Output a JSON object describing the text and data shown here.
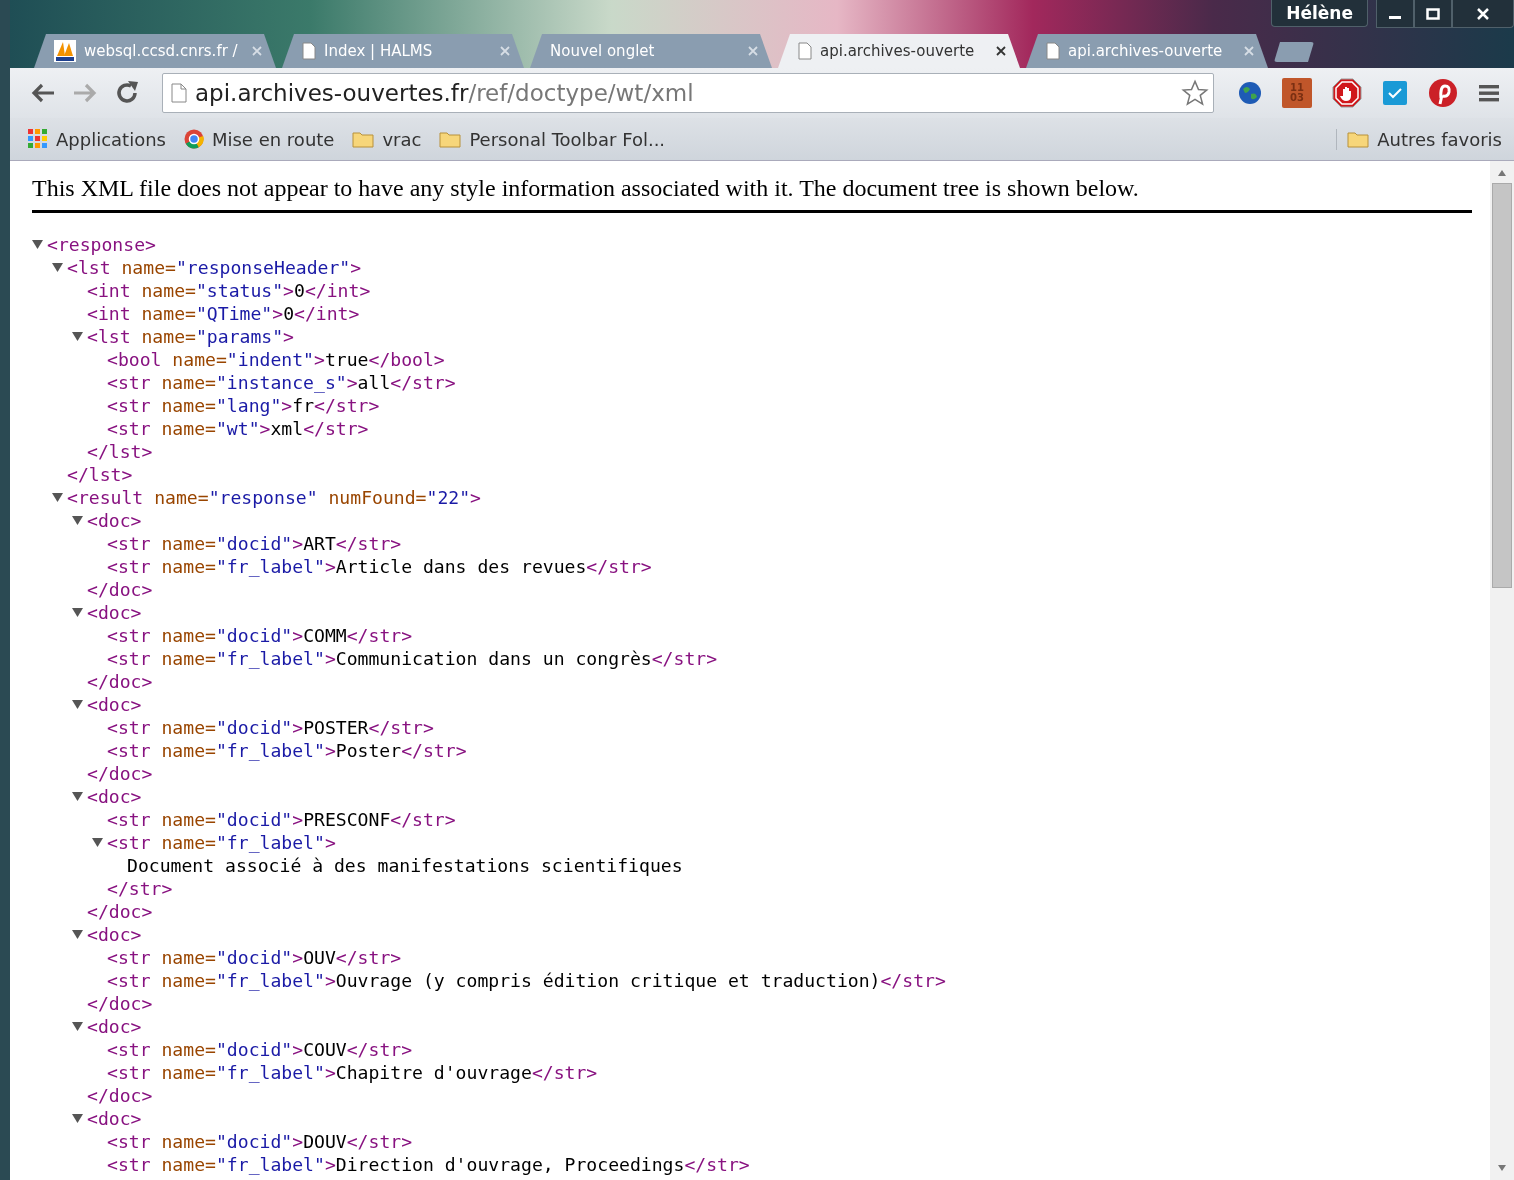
{
  "window": {
    "user": "Hélène"
  },
  "tabs": [
    {
      "title": "websql.ccsd.cnrs.fr /",
      "kind": "site",
      "selected": false
    },
    {
      "title": "Index | HALMS",
      "kind": "page",
      "selected": false
    },
    {
      "title": "Nouvel onglet",
      "kind": "blank",
      "selected": false
    },
    {
      "title": "api.archives-ouverte",
      "kind": "page",
      "selected": true
    },
    {
      "title": "api.archives-ouverte",
      "kind": "page",
      "selected": false
    }
  ],
  "toolbar": {
    "back_disabled": false,
    "forward_disabled": true,
    "url_host": "api.archives-ouvertes.fr",
    "url_path": "/ref/doctype/wt/xml",
    "calendar_day": "11",
    "calendar_month": "03"
  },
  "bookmarks": [
    {
      "label": "Applications",
      "kind": "apps"
    },
    {
      "label": "Mise en route",
      "kind": "site"
    },
    {
      "label": "vrac",
      "kind": "folder"
    },
    {
      "label": "Personal Toolbar Fol...",
      "kind": "folder"
    }
  ],
  "other_bookmarks": {
    "label": "Autres favoris"
  },
  "document": {
    "notice": "This XML file does not appear to have any style information associated with it. The document tree is shown below.",
    "tree": [
      {
        "expanded": true,
        "open": [
          {
            "kind": "tag",
            "text": "<response>"
          }
        ],
        "children": [
          {
            "expanded": true,
            "open": [
              {
                "kind": "tag",
                "text": "<lst"
              },
              {
                "kind": "attr",
                "text": " name="
              },
              {
                "kind": "value",
                "text": "\"responseHeader\""
              },
              {
                "kind": "tag",
                "text": ">"
              }
            ],
            "children": [
              {
                "line": [
                  {
                    "kind": "tag",
                    "text": "<int"
                  },
                  {
                    "kind": "attr",
                    "text": " name="
                  },
                  {
                    "kind": "value",
                    "text": "\"status\""
                  },
                  {
                    "kind": "tag",
                    "text": ">"
                  },
                  {
                    "kind": "text",
                    "text": "0"
                  },
                  {
                    "kind": "tag",
                    "text": "</int>"
                  }
                ]
              },
              {
                "line": [
                  {
                    "kind": "tag",
                    "text": "<int"
                  },
                  {
                    "kind": "attr",
                    "text": " name="
                  },
                  {
                    "kind": "value",
                    "text": "\"QTime\""
                  },
                  {
                    "kind": "tag",
                    "text": ">"
                  },
                  {
                    "kind": "text",
                    "text": "0"
                  },
                  {
                    "kind": "tag",
                    "text": "</int>"
                  }
                ]
              },
              {
                "expanded": true,
                "open": [
                  {
                    "kind": "tag",
                    "text": "<lst"
                  },
                  {
                    "kind": "attr",
                    "text": " name="
                  },
                  {
                    "kind": "value",
                    "text": "\"params\""
                  },
                  {
                    "kind": "tag",
                    "text": ">"
                  }
                ],
                "children": [
                  {
                    "line": [
                      {
                        "kind": "tag",
                        "text": "<bool"
                      },
                      {
                        "kind": "attr",
                        "text": " name="
                      },
                      {
                        "kind": "value",
                        "text": "\"indent\""
                      },
                      {
                        "kind": "tag",
                        "text": ">"
                      },
                      {
                        "kind": "text",
                        "text": "true"
                      },
                      {
                        "kind": "tag",
                        "text": "</bool>"
                      }
                    ]
                  },
                  {
                    "line": [
                      {
                        "kind": "tag",
                        "text": "<str"
                      },
                      {
                        "kind": "attr",
                        "text": " name="
                      },
                      {
                        "kind": "value",
                        "text": "\"instance_s\""
                      },
                      {
                        "kind": "tag",
                        "text": ">"
                      },
                      {
                        "kind": "text",
                        "text": "all"
                      },
                      {
                        "kind": "tag",
                        "text": "</str>"
                      }
                    ]
                  },
                  {
                    "line": [
                      {
                        "kind": "tag",
                        "text": "<str"
                      },
                      {
                        "kind": "attr",
                        "text": " name="
                      },
                      {
                        "kind": "value",
                        "text": "\"lang\""
                      },
                      {
                        "kind": "tag",
                        "text": ">"
                      },
                      {
                        "kind": "text",
                        "text": "fr"
                      },
                      {
                        "kind": "tag",
                        "text": "</str>"
                      }
                    ]
                  },
                  {
                    "line": [
                      {
                        "kind": "tag",
                        "text": "<str"
                      },
                      {
                        "kind": "attr",
                        "text": " name="
                      },
                      {
                        "kind": "value",
                        "text": "\"wt\""
                      },
                      {
                        "kind": "tag",
                        "text": ">"
                      },
                      {
                        "kind": "text",
                        "text": "xml"
                      },
                      {
                        "kind": "tag",
                        "text": "</str>"
                      }
                    ]
                  }
                ],
                "close": [
                  {
                    "kind": "tag",
                    "text": "</lst>"
                  }
                ]
              }
            ],
            "close": [
              {
                "kind": "tag",
                "text": "</lst>"
              }
            ]
          },
          {
            "expanded": true,
            "open": [
              {
                "kind": "tag",
                "text": "<result"
              },
              {
                "kind": "attr",
                "text": " name="
              },
              {
                "kind": "value",
                "text": "\"response\""
              },
              {
                "kind": "attr",
                "text": " numFound="
              },
              {
                "kind": "value",
                "text": "\"22\""
              },
              {
                "kind": "tag",
                "text": ">"
              }
            ],
            "children": [
              {
                "expanded": true,
                "open": [
                  {
                    "kind": "tag",
                    "text": "<doc>"
                  }
                ],
                "children": [
                  {
                    "line": [
                      {
                        "kind": "tag",
                        "text": "<str"
                      },
                      {
                        "kind": "attr",
                        "text": " name="
                      },
                      {
                        "kind": "value",
                        "text": "\"docid\""
                      },
                      {
                        "kind": "tag",
                        "text": ">"
                      },
                      {
                        "kind": "text",
                        "text": "ART"
                      },
                      {
                        "kind": "tag",
                        "text": "</str>"
                      }
                    ]
                  },
                  {
                    "line": [
                      {
                        "kind": "tag",
                        "text": "<str"
                      },
                      {
                        "kind": "attr",
                        "text": " name="
                      },
                      {
                        "kind": "value",
                        "text": "\"fr_label\""
                      },
                      {
                        "kind": "tag",
                        "text": ">"
                      },
                      {
                        "kind": "text",
                        "text": "Article dans des revues"
                      },
                      {
                        "kind": "tag",
                        "text": "</str>"
                      }
                    ]
                  }
                ],
                "close": [
                  {
                    "kind": "tag",
                    "text": "</doc>"
                  }
                ]
              },
              {
                "expanded": true,
                "open": [
                  {
                    "kind": "tag",
                    "text": "<doc>"
                  }
                ],
                "children": [
                  {
                    "line": [
                      {
                        "kind": "tag",
                        "text": "<str"
                      },
                      {
                        "kind": "attr",
                        "text": " name="
                      },
                      {
                        "kind": "value",
                        "text": "\"docid\""
                      },
                      {
                        "kind": "tag",
                        "text": ">"
                      },
                      {
                        "kind": "text",
                        "text": "COMM"
                      },
                      {
                        "kind": "tag",
                        "text": "</str>"
                      }
                    ]
                  },
                  {
                    "line": [
                      {
                        "kind": "tag",
                        "text": "<str"
                      },
                      {
                        "kind": "attr",
                        "text": " name="
                      },
                      {
                        "kind": "value",
                        "text": "\"fr_label\""
                      },
                      {
                        "kind": "tag",
                        "text": ">"
                      },
                      {
                        "kind": "text",
                        "text": "Communication dans un congrès"
                      },
                      {
                        "kind": "tag",
                        "text": "</str>"
                      }
                    ]
                  }
                ],
                "close": [
                  {
                    "kind": "tag",
                    "text": "</doc>"
                  }
                ]
              },
              {
                "expanded": true,
                "open": [
                  {
                    "kind": "tag",
                    "text": "<doc>"
                  }
                ],
                "children": [
                  {
                    "line": [
                      {
                        "kind": "tag",
                        "text": "<str"
                      },
                      {
                        "kind": "attr",
                        "text": " name="
                      },
                      {
                        "kind": "value",
                        "text": "\"docid\""
                      },
                      {
                        "kind": "tag",
                        "text": ">"
                      },
                      {
                        "kind": "text",
                        "text": "POSTER"
                      },
                      {
                        "kind": "tag",
                        "text": "</str>"
                      }
                    ]
                  },
                  {
                    "line": [
                      {
                        "kind": "tag",
                        "text": "<str"
                      },
                      {
                        "kind": "attr",
                        "text": " name="
                      },
                      {
                        "kind": "value",
                        "text": "\"fr_label\""
                      },
                      {
                        "kind": "tag",
                        "text": ">"
                      },
                      {
                        "kind": "text",
                        "text": "Poster"
                      },
                      {
                        "kind": "tag",
                        "text": "</str>"
                      }
                    ]
                  }
                ],
                "close": [
                  {
                    "kind": "tag",
                    "text": "</doc>"
                  }
                ]
              },
              {
                "expanded": true,
                "open": [
                  {
                    "kind": "tag",
                    "text": "<doc>"
                  }
                ],
                "children": [
                  {
                    "line": [
                      {
                        "kind": "tag",
                        "text": "<str"
                      },
                      {
                        "kind": "attr",
                        "text": " name="
                      },
                      {
                        "kind": "value",
                        "text": "\"docid\""
                      },
                      {
                        "kind": "tag",
                        "text": ">"
                      },
                      {
                        "kind": "text",
                        "text": "PRESCONF"
                      },
                      {
                        "kind": "tag",
                        "text": "</str>"
                      }
                    ]
                  },
                  {
                    "expanded": true,
                    "open": [
                      {
                        "kind": "tag",
                        "text": "<str"
                      },
                      {
                        "kind": "attr",
                        "text": " name="
                      },
                      {
                        "kind": "value",
                        "text": "\"fr_label\""
                      },
                      {
                        "kind": "tag",
                        "text": ">"
                      }
                    ],
                    "children": [
                      {
                        "line": [
                          {
                            "kind": "text",
                            "text": "Document associé à des manifestations scientifiques"
                          }
                        ]
                      }
                    ],
                    "close": [
                      {
                        "kind": "tag",
                        "text": "</str>"
                      }
                    ]
                  }
                ],
                "close": [
                  {
                    "kind": "tag",
                    "text": "</doc>"
                  }
                ]
              },
              {
                "expanded": true,
                "open": [
                  {
                    "kind": "tag",
                    "text": "<doc>"
                  }
                ],
                "children": [
                  {
                    "line": [
                      {
                        "kind": "tag",
                        "text": "<str"
                      },
                      {
                        "kind": "attr",
                        "text": " name="
                      },
                      {
                        "kind": "value",
                        "text": "\"docid\""
                      },
                      {
                        "kind": "tag",
                        "text": ">"
                      },
                      {
                        "kind": "text",
                        "text": "OUV"
                      },
                      {
                        "kind": "tag",
                        "text": "</str>"
                      }
                    ]
                  },
                  {
                    "line": [
                      {
                        "kind": "tag",
                        "text": "<str"
                      },
                      {
                        "kind": "attr",
                        "text": " name="
                      },
                      {
                        "kind": "value",
                        "text": "\"fr_label\""
                      },
                      {
                        "kind": "tag",
                        "text": ">"
                      },
                      {
                        "kind": "text",
                        "text": "Ouvrage (y compris édition critique et traduction)"
                      },
                      {
                        "kind": "tag",
                        "text": "</str>"
                      }
                    ]
                  }
                ],
                "close": [
                  {
                    "kind": "tag",
                    "text": "</doc>"
                  }
                ]
              },
              {
                "expanded": true,
                "open": [
                  {
                    "kind": "tag",
                    "text": "<doc>"
                  }
                ],
                "children": [
                  {
                    "line": [
                      {
                        "kind": "tag",
                        "text": "<str"
                      },
                      {
                        "kind": "attr",
                        "text": " name="
                      },
                      {
                        "kind": "value",
                        "text": "\"docid\""
                      },
                      {
                        "kind": "tag",
                        "text": ">"
                      },
                      {
                        "kind": "text",
                        "text": "COUV"
                      },
                      {
                        "kind": "tag",
                        "text": "</str>"
                      }
                    ]
                  },
                  {
                    "line": [
                      {
                        "kind": "tag",
                        "text": "<str"
                      },
                      {
                        "kind": "attr",
                        "text": " name="
                      },
                      {
                        "kind": "value",
                        "text": "\"fr_label\""
                      },
                      {
                        "kind": "tag",
                        "text": ">"
                      },
                      {
                        "kind": "text",
                        "text": "Chapitre d'ouvrage"
                      },
                      {
                        "kind": "tag",
                        "text": "</str>"
                      }
                    ]
                  }
                ],
                "close": [
                  {
                    "kind": "tag",
                    "text": "</doc>"
                  }
                ]
              },
              {
                "expanded": true,
                "open": [
                  {
                    "kind": "tag",
                    "text": "<doc>"
                  }
                ],
                "children": [
                  {
                    "line": [
                      {
                        "kind": "tag",
                        "text": "<str"
                      },
                      {
                        "kind": "attr",
                        "text": " name="
                      },
                      {
                        "kind": "value",
                        "text": "\"docid\""
                      },
                      {
                        "kind": "tag",
                        "text": ">"
                      },
                      {
                        "kind": "text",
                        "text": "DOUV"
                      },
                      {
                        "kind": "tag",
                        "text": "</str>"
                      }
                    ]
                  },
                  {
                    "line": [
                      {
                        "kind": "tag",
                        "text": "<str"
                      },
                      {
                        "kind": "attr",
                        "text": " name="
                      },
                      {
                        "kind": "value",
                        "text": "\"fr_label\""
                      },
                      {
                        "kind": "tag",
                        "text": ">"
                      },
                      {
                        "kind": "text",
                        "text": "Direction d'ouvrage, Proceedings"
                      },
                      {
                        "kind": "tag",
                        "text": "</str>"
                      }
                    ]
                  }
                ]
              }
            ]
          }
        ]
      }
    ]
  }
}
